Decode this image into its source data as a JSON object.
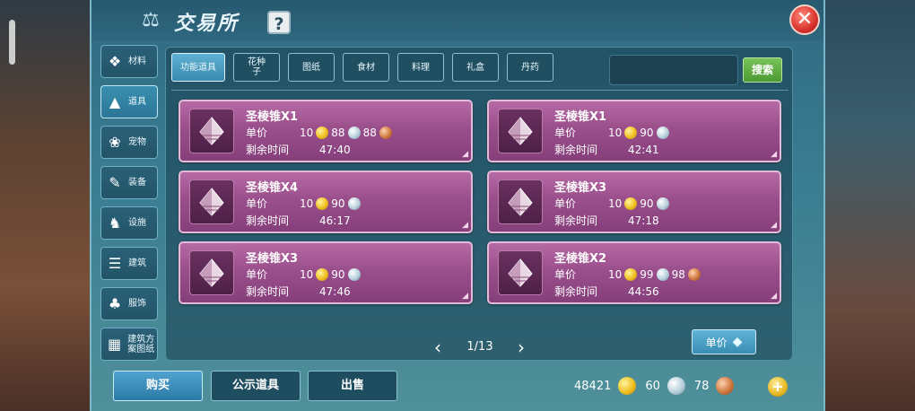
{
  "header": {
    "title": "交易所",
    "help_label": "?",
    "close_label": "✕"
  },
  "sidebar": {
    "items": [
      {
        "label": "材料",
        "icon": "material-icon",
        "active": false
      },
      {
        "label": "道具",
        "icon": "prop-icon",
        "active": true
      },
      {
        "label": "宠物",
        "icon": "paw-icon",
        "active": false
      },
      {
        "label": "装备",
        "icon": "equip-icon",
        "active": false
      },
      {
        "label": "设施",
        "icon": "facility-icon",
        "active": false
      },
      {
        "label": "建筑",
        "icon": "building-icon",
        "active": false
      },
      {
        "label": "服饰",
        "icon": "clothing-icon",
        "active": false
      },
      {
        "label": "建筑方案图纸",
        "icon": "blueprint-icon",
        "active": false
      }
    ]
  },
  "tabs": [
    {
      "label": "功能道具",
      "active": true
    },
    {
      "label": "花种子",
      "active": false
    },
    {
      "label": "图纸",
      "active": false
    },
    {
      "label": "食材",
      "active": false
    },
    {
      "label": "料理",
      "active": false
    },
    {
      "label": "礼盒",
      "active": false
    },
    {
      "label": "丹药",
      "active": false
    }
  ],
  "search": {
    "placeholder": "",
    "button_label": "搜索"
  },
  "labels": {
    "unit_price": "单价",
    "remaining_time": "剩余时间"
  },
  "listings": [
    {
      "name": "圣棱锥X1",
      "qty": "10",
      "gold": "88",
      "silver": "88",
      "time": "47:40"
    },
    {
      "name": "圣棱锥X1",
      "qty": "10",
      "gold": "90",
      "silver": "",
      "time": "42:41"
    },
    {
      "name": "圣棱锥X4",
      "qty": "10",
      "gold": "90",
      "silver": "",
      "time": "46:17"
    },
    {
      "name": "圣棱锥X3",
      "qty": "10",
      "gold": "90",
      "silver": "",
      "time": "47:18"
    },
    {
      "name": "圣棱锥X3",
      "qty": "10",
      "gold": "90",
      "silver": "",
      "time": "47:46"
    },
    {
      "name": "圣棱锥X2",
      "qty": "10",
      "gold": "99",
      "silver": "98",
      "time": "44:56"
    }
  ],
  "pagination": {
    "text": "1/13",
    "prev": "‹",
    "next": "›"
  },
  "sort": {
    "label": "单价"
  },
  "bottom": {
    "buy_label": "购买",
    "show_label": "公示道具",
    "sell_label": "出售",
    "currency": {
      "gold": "48421",
      "silver": "60",
      "copper": "78"
    },
    "plus_label": "+"
  },
  "colors": {
    "panel": "#3c7f92",
    "card": "#9a4f8c",
    "active_tab": "#3b8bb0",
    "search_button": "#4c9a34"
  }
}
